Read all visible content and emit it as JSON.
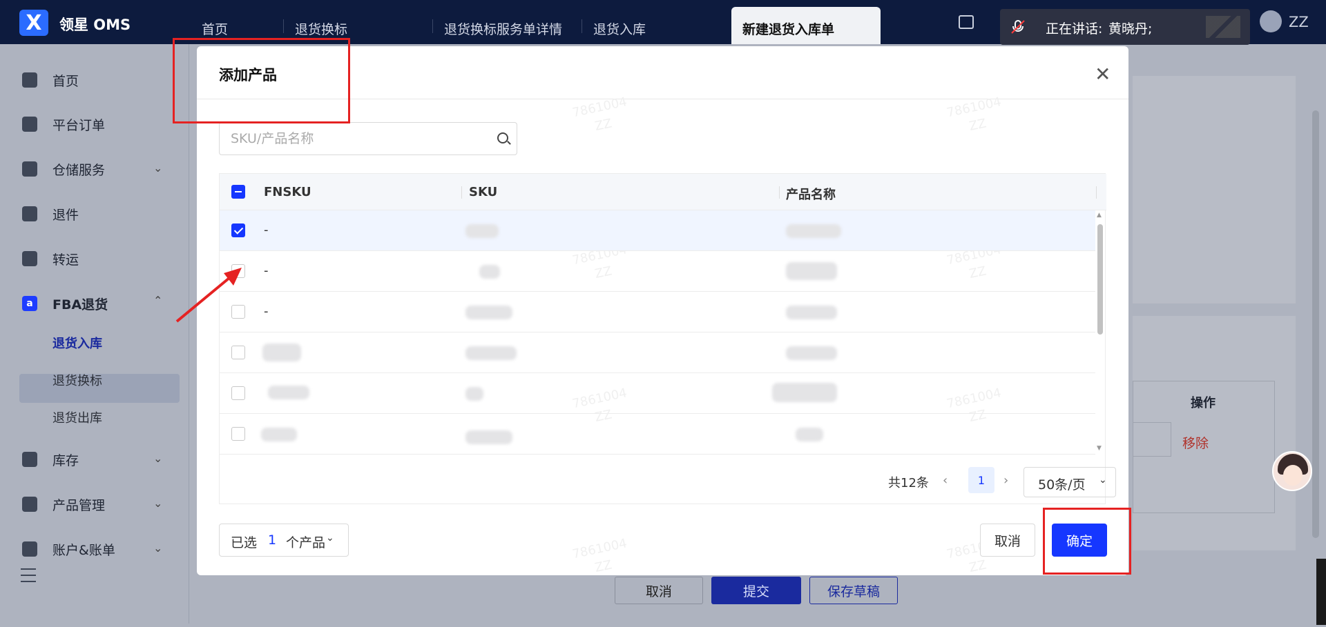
{
  "header": {
    "brand": "领星 OMS",
    "tabs": [
      "首页",
      "退货换标",
      "退货换标服务单详情",
      "退货入库"
    ],
    "active_tab": "新建退货入库单",
    "speaking_label": "正在讲话:",
    "speaking_name": "黄晓丹;",
    "user": "ZZ"
  },
  "sidebar": {
    "items": [
      "首页",
      "平台订单",
      "仓储服务",
      "退件",
      "转运",
      "FBA退货",
      "库存",
      "产品管理",
      "账户&账单"
    ],
    "sub_items": [
      "退货入库",
      "退货换标",
      "退货出库"
    ]
  },
  "background": {
    "table_header": "操作",
    "remove_link": "移除",
    "buttons": {
      "cancel": "取消",
      "submit": "提交",
      "save_draft": "保存草稿"
    }
  },
  "dialog": {
    "title": "添加产品",
    "search_placeholder": "SKU/产品名称",
    "columns": [
      "FNSKU",
      "SKU",
      "产品名称"
    ],
    "rows": [
      {
        "fnsku": "-",
        "checked": true
      },
      {
        "fnsku": "-",
        "checked": false
      },
      {
        "fnsku": "-",
        "checked": false
      },
      {
        "fnsku": "",
        "checked": false
      },
      {
        "fnsku": "",
        "checked": false
      },
      {
        "fnsku": "",
        "checked": false
      }
    ],
    "pagination": {
      "total": "共12条",
      "page": "1",
      "page_size": "50条/页"
    },
    "selected": {
      "prefix": "已选",
      "count": "1",
      "suffix": "个产品"
    },
    "buttons": {
      "cancel": "取消",
      "confirm": "确定"
    },
    "watermark": [
      "7861004",
      "ZZ"
    ]
  },
  "colors": {
    "primary": "#1637ff",
    "header_bg": "#0d1b3e",
    "annotation": "#e52222",
    "danger": "#b0322b"
  }
}
